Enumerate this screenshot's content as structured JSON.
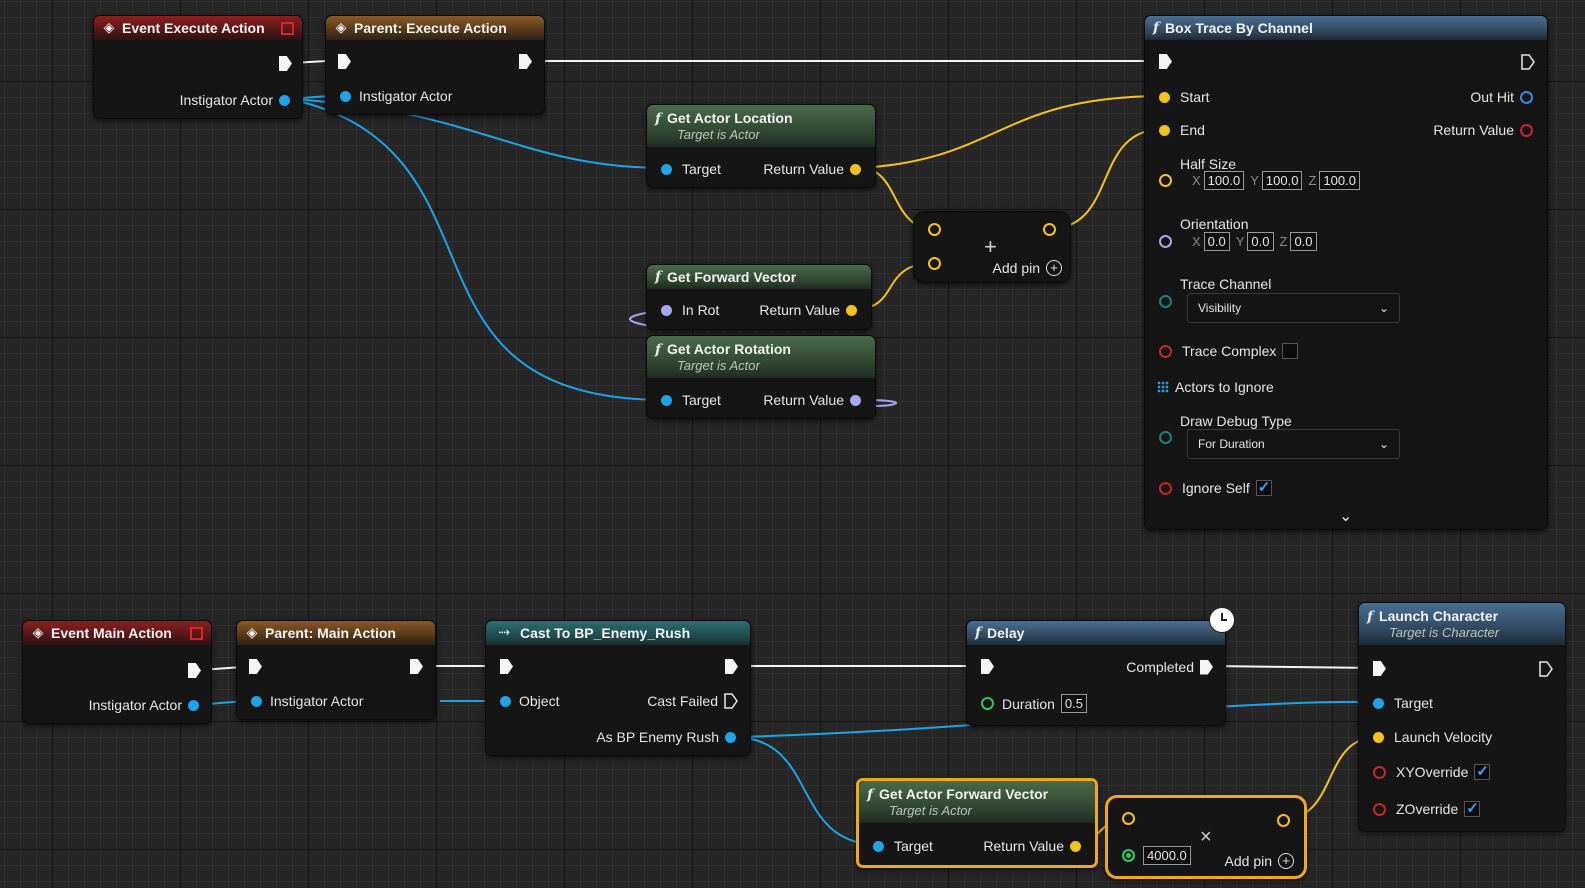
{
  "graph": {
    "top_row": {
      "event_execute_action": {
        "title": "Event Execute Action",
        "pin_instigator": "Instigator Actor"
      },
      "parent_execute_action": {
        "title": "Parent: Execute Action",
        "pin_instigator": "Instigator Actor"
      },
      "get_actor_location": {
        "title": "Get Actor Location",
        "subtitle": "Target is Actor",
        "pin_target": "Target",
        "pin_return": "Return Value"
      },
      "get_forward_vector": {
        "title": "Get Forward Vector",
        "pin_in": "In Rot",
        "pin_return": "Return Value"
      },
      "get_actor_rotation": {
        "title": "Get Actor Rotation",
        "subtitle": "Target is Actor",
        "pin_target": "Target",
        "pin_return": "Return Value"
      },
      "add_node": {
        "symbol": "+",
        "add_pin_label": "Add pin"
      },
      "box_trace": {
        "title": "Box Trace By Channel",
        "pin_start": "Start",
        "pin_end": "End",
        "pin_out_hit": "Out Hit",
        "pin_return": "Return Value",
        "half_size_label": "Half Size",
        "half_size": {
          "x": "100.0",
          "y": "100.0",
          "z": "100.0"
        },
        "orientation_label": "Orientation",
        "orientation": {
          "x": "0.0",
          "y": "0.0",
          "z": "0.0"
        },
        "axis_x": "X",
        "axis_y": "Y",
        "axis_z": "Z",
        "trace_channel_label": "Trace Channel",
        "trace_channel_value": "Visibility",
        "trace_complex_label": "Trace Complex",
        "actors_to_ignore_label": "Actors to Ignore",
        "draw_debug_label": "Draw Debug Type",
        "draw_debug_value": "For Duration",
        "ignore_self_label": "Ignore Self",
        "ignore_self_checked": true,
        "expand_glyph": "⌄"
      }
    },
    "bottom_row": {
      "event_main_action": {
        "title": "Event Main Action",
        "pin_instigator": "Instigator Actor"
      },
      "parent_main_action": {
        "title": "Parent: Main Action",
        "pin_instigator": "Instigator Actor"
      },
      "cast": {
        "title": "Cast To BP_Enemy_Rush",
        "pin_object": "Object",
        "pin_cast_failed": "Cast Failed",
        "pin_as": "As BP Enemy Rush"
      },
      "delay": {
        "title": "Delay",
        "pin_completed": "Completed",
        "pin_duration": "Duration",
        "duration_value": "0.5"
      },
      "get_actor_forward_vector": {
        "title": "Get Actor Forward Vector",
        "subtitle": "Target is Actor",
        "pin_target": "Target",
        "pin_return": "Return Value"
      },
      "multiply_node": {
        "symbol": "×",
        "value": "4000.0",
        "add_pin_label": "Add pin"
      },
      "launch_character": {
        "title": "Launch Character",
        "subtitle": "Target is Character",
        "pin_target": "Target",
        "pin_velocity": "Launch Velocity",
        "pin_xy": "XYOverride",
        "pin_z": "ZOverride",
        "xy_checked": true,
        "z_checked": true
      }
    }
  },
  "colors": {
    "exec": "#f5f5f5",
    "object": "#1ea3e6",
    "vector": "#f5c21b",
    "rotator": "#a3a8f0",
    "float": "#36c45a",
    "struct_blue": "#3b8be0",
    "bool": "#c4262b",
    "byte": "#22807a",
    "selection": "#f0a91a"
  },
  "icons": {
    "event": "event-diamond-icon",
    "function": "function-f-icon",
    "cast": "cast-arrow-icon",
    "clock": "clock-icon",
    "add": "add-circle-icon",
    "dropdown": "chevron-down-icon"
  }
}
